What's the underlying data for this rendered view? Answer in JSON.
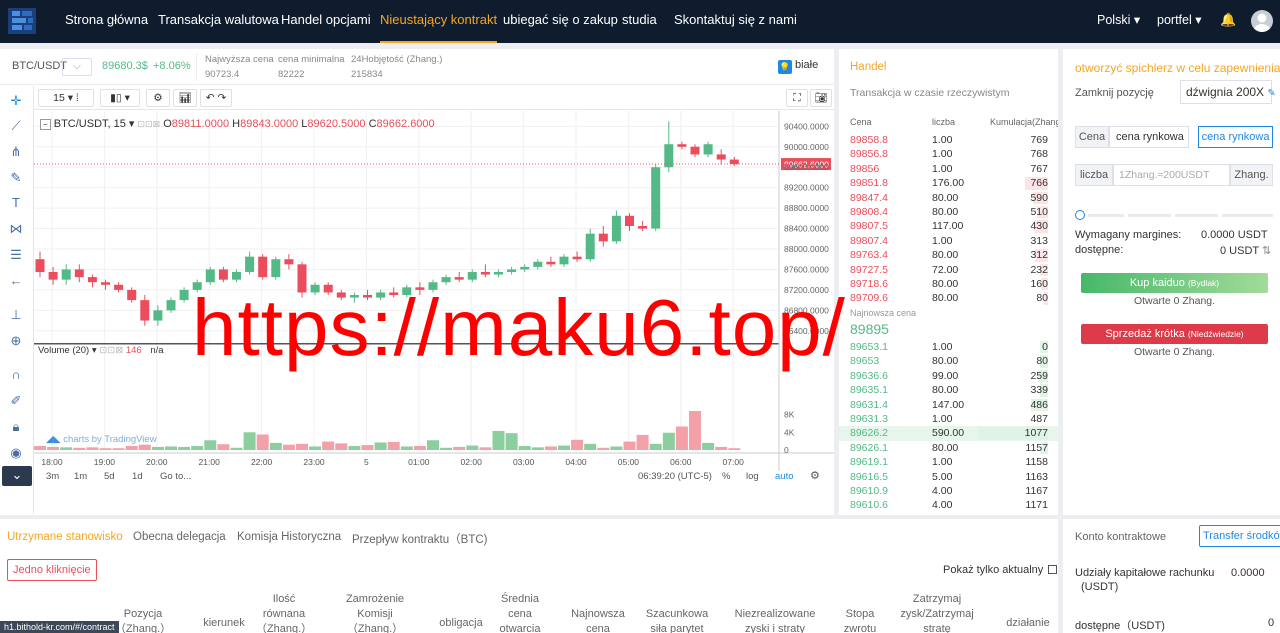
{
  "nav": {
    "items": [
      "Strona główna",
      "Transakcja walutowa",
      "Handel opcjami",
      "Nieustający kontrakt",
      "ubiegać się o zakup",
      "studia",
      "Skontaktuj się z nami"
    ],
    "active_index": 3,
    "language": "Polski",
    "wallet": "portfel"
  },
  "ticker": {
    "symbol": "BTC/USDT",
    "price": "89680.3$",
    "change": "+8.06%",
    "high_label": "Najwyższa cena",
    "high": "90723.4",
    "low_label": "cena minimalna",
    "low": "82222",
    "vol_label": "24Hobjętość (Zhang.)",
    "vol": "215834",
    "theme": "białe"
  },
  "chart_toolbar": {
    "interval": "15"
  },
  "chart_legend": {
    "symbol": "BTC/USDT, 15",
    "open": "89811.0000",
    "high": "89843.0000",
    "low": "89620.5000",
    "close": "89662.6000",
    "volume_label": "Volume (20)",
    "volume_value": "146",
    "volume_na": "n/a",
    "credit": "charts by TradingView"
  },
  "chart_bottom": {
    "ranges": [
      "3m",
      "1m",
      "5d",
      "1d"
    ],
    "goto": "Go to...",
    "time": "06:39:20 (UTC-5)",
    "pct": "%",
    "log": "log",
    "auto": "auto"
  },
  "colors": {
    "up": "#53b987",
    "down": "#eb4d5c",
    "accent": "#f5a623",
    "nav_bg": "#0f1c2e",
    "blue": "#1e88e5"
  },
  "chart_data": {
    "type": "candlestick",
    "x_ticks": [
      "18:00",
      "19:00",
      "20:00",
      "21:00",
      "22:00",
      "23:00",
      "5",
      "01:00",
      "02:00",
      "03:00",
      "04:00",
      "05:00",
      "06:00",
      "07:00"
    ],
    "price_ticks": [
      90400,
      90000,
      89600,
      89200,
      88800,
      88400,
      88000,
      87600,
      87200,
      86800,
      86400
    ],
    "ylim": [
      86200,
      90700
    ],
    "last_price_label": "89662.6000",
    "volume_ticks": [
      "8K",
      "4K",
      "0"
    ],
    "vol_max": 8800,
    "candles": [
      [
        87800,
        87950,
        87450,
        87550
      ],
      [
        87550,
        87650,
        87300,
        87400
      ],
      [
        87400,
        87700,
        87300,
        87600
      ],
      [
        87600,
        87700,
        87350,
        87450
      ],
      [
        87450,
        87500,
        87250,
        87350
      ],
      [
        87350,
        87400,
        87200,
        87300
      ],
      [
        87300,
        87350,
        87150,
        87200
      ],
      [
        87200,
        87250,
        86950,
        87000
      ],
      [
        87000,
        87100,
        86500,
        86600
      ],
      [
        86600,
        86900,
        86500,
        86800
      ],
      [
        86800,
        87050,
        86750,
        87000
      ],
      [
        87000,
        87250,
        86950,
        87200
      ],
      [
        87200,
        87400,
        87150,
        87350
      ],
      [
        87350,
        87650,
        87300,
        87600
      ],
      [
        87600,
        87650,
        87350,
        87400
      ],
      [
        87400,
        87600,
        87350,
        87550
      ],
      [
        87550,
        87950,
        87500,
        87850
      ],
      [
        87850,
        87900,
        87400,
        87450
      ],
      [
        87450,
        87850,
        87400,
        87800
      ],
      [
        87800,
        87900,
        87600,
        87700
      ],
      [
        87700,
        87750,
        87050,
        87150
      ],
      [
        87150,
        87350,
        87100,
        87300
      ],
      [
        87300,
        87350,
        87100,
        87150
      ],
      [
        87150,
        87200,
        87000,
        87050
      ],
      [
        87050,
        87150,
        86950,
        87100
      ],
      [
        87100,
        87200,
        87000,
        87050
      ],
      [
        87050,
        87200,
        87000,
        87150
      ],
      [
        87150,
        87250,
        87050,
        87100
      ],
      [
        87100,
        87300,
        87050,
        87250
      ],
      [
        87250,
        87350,
        87100,
        87200
      ],
      [
        87200,
        87400,
        87150,
        87350
      ],
      [
        87350,
        87500,
        87300,
        87450
      ],
      [
        87450,
        87550,
        87350,
        87400
      ],
      [
        87400,
        87600,
        87350,
        87550
      ],
      [
        87550,
        87700,
        87450,
        87500
      ],
      [
        87500,
        87600,
        87450,
        87550
      ],
      [
        87550,
        87650,
        87500,
        87600
      ],
      [
        87600,
        87700,
        87550,
        87650
      ],
      [
        87650,
        87800,
        87600,
        87750
      ],
      [
        87750,
        87850,
        87650,
        87700
      ],
      [
        87700,
        87900,
        87650,
        87850
      ],
      [
        87850,
        87950,
        87750,
        87800
      ],
      [
        87800,
        88400,
        87750,
        88300
      ],
      [
        88300,
        88450,
        88050,
        88150
      ],
      [
        88150,
        88750,
        88100,
        88650
      ],
      [
        88650,
        88700,
        88350,
        88450
      ],
      [
        88450,
        88550,
        88350,
        88400
      ],
      [
        88400,
        89650,
        88350,
        89600
      ],
      [
        89600,
        90500,
        89500,
        90050
      ],
      [
        90050,
        90100,
        89950,
        90000
      ],
      [
        90000,
        90050,
        89800,
        89850
      ],
      [
        89850,
        90100,
        89800,
        90050
      ],
      [
        89850,
        89950,
        89650,
        89750
      ],
      [
        89750,
        89800,
        89620,
        89662
      ]
    ],
    "volume": [
      900,
      700,
      600,
      500,
      600,
      400,
      400,
      900,
      1200,
      700,
      800,
      700,
      900,
      2200,
      1300,
      500,
      4000,
      3500,
      1600,
      1200,
      1400,
      800,
      1900,
      1500,
      900,
      1100,
      1700,
      1800,
      800,
      900,
      2200,
      500,
      700,
      1000,
      600,
      4300,
      3800,
      900,
      600,
      800,
      1000,
      2300,
      1400,
      500,
      800,
      1900,
      3400,
      1400,
      3900,
      5300,
      8800,
      1600,
      700,
      400
    ]
  },
  "trades": {
    "title": "Handel",
    "subtitle": "Transakcja w czasie rzeczywistym",
    "col_price": "Cena",
    "col_qty": "liczba",
    "col_cum": "Kumulacja(Zhang.)",
    "asks": [
      {
        "p": "89858.8",
        "q": "1.00",
        "c": "769",
        "bar": 0
      },
      {
        "p": "89856.8",
        "q": "1.00",
        "c": "768",
        "bar": 0
      },
      {
        "p": "89856",
        "q": "1.00",
        "c": "767",
        "bar": 0
      },
      {
        "p": "89851.8",
        "q": "176.00",
        "c": "766",
        "bar": 0.33
      },
      {
        "p": "89847.4",
        "q": "80.00",
        "c": "590",
        "bar": 0.22
      },
      {
        "p": "89808.4",
        "q": "80.00",
        "c": "510",
        "bar": 0.16
      },
      {
        "p": "89807.5",
        "q": "117.00",
        "c": "430",
        "bar": 0.2
      },
      {
        "p": "89807.4",
        "q": "1.00",
        "c": "313",
        "bar": 0
      },
      {
        "p": "89763.4",
        "q": "80.00",
        "c": "312",
        "bar": 0.18
      },
      {
        "p": "89727.5",
        "q": "72.00",
        "c": "232",
        "bar": 0.12
      },
      {
        "p": "89718.6",
        "q": "80.00",
        "c": "160",
        "bar": 0.1
      },
      {
        "p": "89709.6",
        "q": "80.00",
        "c": "80",
        "bar": 0.06
      }
    ],
    "latest_label": "Najnowsza cena",
    "latest_price": "89895",
    "bids": [
      {
        "p": "89653.1",
        "q": "1.00",
        "c": "0",
        "bar": 0.12
      },
      {
        "p": "89653",
        "q": "80.00",
        "c": "80",
        "bar": 0.12
      },
      {
        "p": "89636.6",
        "q": "99.00",
        "c": "259",
        "bar": 0.14
      },
      {
        "p": "89635.1",
        "q": "80.00",
        "c": "339",
        "bar": 0.12
      },
      {
        "p": "89631.4",
        "q": "147.00",
        "c": "486",
        "bar": 0.25
      },
      {
        "p": "89631.3",
        "q": "1.00",
        "c": "487",
        "bar": 0
      },
      {
        "p": "89626.2",
        "q": "590.00",
        "c": "1077",
        "bar": 1
      },
      {
        "p": "89626.1",
        "q": "80.00",
        "c": "1157",
        "bar": 0.1
      },
      {
        "p": "89619.1",
        "q": "1.00",
        "c": "1158",
        "bar": 0
      },
      {
        "p": "89616.5",
        "q": "5.00",
        "c": "1163",
        "bar": 0
      },
      {
        "p": "89610.9",
        "q": "4.00",
        "c": "1167",
        "bar": 0
      },
      {
        "p": "89610.6",
        "q": "4.00",
        "c": "1171",
        "bar": 0
      }
    ]
  },
  "order": {
    "title": "otworzyć spichlerz w celu zapewnienia ulgi",
    "close_pos": "Zamknij pozycję",
    "leverage": "dźwignia 200X",
    "price_label": "Cena",
    "price_value": "cena rynkowa",
    "market_btn": "cena rynkowa",
    "qty_label": "liczba",
    "qty_placeholder": "1Zhang.≈200USDT",
    "unit": "Zhang.",
    "margin_label": "Wymagany margines:",
    "margin_value": "0.0000 USDT",
    "avail_label": "dostępne:",
    "avail_value": "0 USDT",
    "buy_label": "Kup kaiduo",
    "buy_sub": "(Bydlak)",
    "buy_open": "Otwarte 0 Zhang.",
    "sell_label": "Sprzedaż krótka",
    "sell_sub": "(Niedźwiedzie)",
    "sell_open": "Otwarte 0 Zhang."
  },
  "positions": {
    "tabs": [
      "Utrzymane stanowisko",
      "Obecna delegacja",
      "Komisja Historyczna",
      "Przepływ kontraktu（BTC)"
    ],
    "one_click": "Jedno kliknięcie",
    "show_current": "Pokaż tylko aktualny",
    "columns": [
      [
        "Pozycja",
        "（Zhang.）"
      ],
      [
        "kierunek"
      ],
      [
        "Ilość",
        "równana",
        "（Zhang.）"
      ],
      [
        "Zamrożenie",
        "Komisji",
        "（Zhang.）"
      ],
      [
        "obligacja"
      ],
      [
        "Średnia",
        "cena",
        "otwarcia"
      ],
      [
        "Najnowsza",
        "cena"
      ],
      [
        "Szacunkowa",
        "siła parytet"
      ],
      [
        "Niezrealizowane",
        "zyski i straty"
      ],
      [
        "Stopa",
        "zwrotu"
      ],
      [
        "Zatrzymaj",
        "zysk/Zatrzymaj",
        "stratę"
      ],
      [
        "działanie"
      ]
    ]
  },
  "account": {
    "title": "Konto kontraktowe",
    "transfer": "Transfer środków",
    "equity_label": "Udziały kapitałowe rachunku",
    "equity_unit": "(USDT)",
    "equity_value": "0.0000",
    "avail_label": "dostępne（USDT)",
    "avail_value": "0"
  },
  "watermark": "https://maku6.top/",
  "url_tip": "h1.bithold-kr.com/#/contract"
}
